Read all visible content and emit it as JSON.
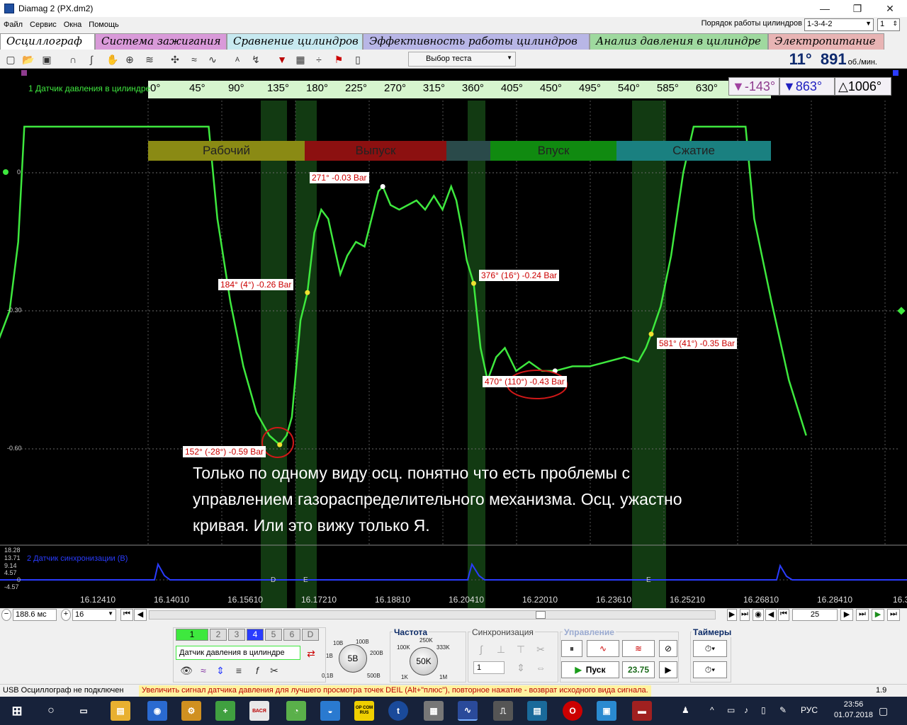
{
  "window": {
    "title": "Diamag 2 (PX.dm2)",
    "minimize": "—",
    "maximize": "❐",
    "close": "✕"
  },
  "menu": [
    "Файл",
    "Сервис",
    "Окна",
    "Помощь"
  ],
  "cylinder_order": {
    "label": "Порядок работы цилиндров",
    "value": "1-3-4-2",
    "cylinder": "1"
  },
  "tabs": [
    {
      "label": "Осциллограф",
      "color": "#ffffff",
      "active": true
    },
    {
      "label": "Система зажигания",
      "color": "#d99ad9"
    },
    {
      "label": "Сравнение цилиндров",
      "color": "#c7e9f0"
    },
    {
      "label": "Эффективность работы цилиндров",
      "color": "#b8b6e6"
    },
    {
      "label": "Анализ давления в цилиндре",
      "color": "#9fd99f"
    },
    {
      "label": "Электропитание",
      "color": "#e8b4b4"
    }
  ],
  "toolbar": {
    "test_select": "Выбор теста",
    "icons": [
      "new-file-icon",
      "open-icon",
      "save-icon",
      "trigger-rise-icon",
      "trigger-fall-icon",
      "hand-icon",
      "zoom-icon",
      "stack-icon",
      "cross-icon",
      "wave-icon",
      "wave-alt-icon",
      "auto-icon",
      "auto-zero-icon",
      "filter-icon",
      "grid-icon",
      "split-icon",
      "flag-icon",
      "page-icon"
    ]
  },
  "rpm": {
    "angle": "11°",
    "value": "891",
    "unit": "об./мин."
  },
  "scope": {
    "channel_title": "1 Датчик давления в цилиндре",
    "angle_labels": [
      "0°",
      "45°",
      "90°",
      "135°",
      "180°",
      "225°",
      "270°",
      "315°",
      "360°",
      "405°",
      "450°",
      "495°",
      "540°",
      "585°",
      "630°",
      "6"
    ],
    "phases": [
      {
        "label": "Рабочий",
        "color": "#8a8a14"
      },
      {
        "label": "Выпуск",
        "color": "#8c1010"
      },
      {
        "label": "",
        "color": "#2a4a4a"
      },
      {
        "label": "Впуск",
        "color": "#108a10"
      },
      {
        "label": "Сжатие",
        "color": "#1a8080"
      }
    ],
    "markers": {
      "m1": "-143°",
      "m2": "863°",
      "delta": "1006°"
    },
    "y_labels": [
      "0",
      "-0.30",
      "-0.60"
    ],
    "tags": [
      "271° -0.03 Bar",
      "184° (4°) -0.26 Bar",
      "376° (16°) -0.24 Bar",
      "581° (41°) -0.35 Bar",
      "470° (110°) -0.43 Bar",
      "152° (-28°) -0.59 Bar"
    ],
    "comment": "Только по одному виду осц. понятно что есть проблемы с управлением газораспределительного механизма. Осц. ужастно кривая. Или это вижу только Я.",
    "sync_title": "2 Датчик синхронизации (В)",
    "sync_labels": [
      "18.28",
      "13.71",
      "9.14",
      "4.57",
      "0",
      "-4.57"
    ],
    "sync_letters": [
      "D",
      "E",
      "E"
    ],
    "time_labels": [
      "16.12410",
      "16.14010",
      "16.15610",
      "16.17210",
      "16.18810",
      "16.20410",
      "16.22010",
      "16.23610",
      "16.25210",
      "16.26810",
      "16.28410",
      "16.3"
    ]
  },
  "chart_data": {
    "type": "line",
    "xlabel": "",
    "ylabel": "",
    "y_ticks": [
      0,
      -0.3,
      -0.6
    ],
    "x_ticks_deg": [
      0,
      45,
      90,
      135,
      180,
      225,
      270,
      315,
      360,
      405,
      450,
      495,
      540,
      585,
      630
    ],
    "series": [
      {
        "values_deg": [
          [
            -172,
            -0.36
          ],
          [
            -160,
            -0.3
          ],
          [
            -150,
            -0.15
          ],
          [
            -143,
            0.1
          ],
          [
            70,
            0.1
          ],
          [
            80,
            -0.1
          ],
          [
            95,
            -0.28
          ],
          [
            110,
            -0.42
          ],
          [
            125,
            -0.52
          ],
          [
            140,
            -0.57
          ],
          [
            152,
            -0.59
          ],
          [
            160,
            -0.57
          ],
          [
            166,
            -0.53
          ],
          [
            176,
            -0.32
          ],
          [
            184,
            -0.26
          ],
          [
            192,
            -0.13
          ],
          [
            200,
            -0.08
          ],
          [
            208,
            -0.1
          ],
          [
            215,
            -0.16
          ],
          [
            222,
            -0.22
          ],
          [
            230,
            -0.18
          ],
          [
            240,
            -0.15
          ],
          [
            250,
            -0.16
          ],
          [
            258,
            -0.1
          ],
          [
            266,
            -0.04
          ],
          [
            271,
            -0.03
          ],
          [
            280,
            -0.07
          ],
          [
            290,
            -0.08
          ],
          [
            300,
            -0.07
          ],
          [
            310,
            -0.06
          ],
          [
            320,
            -0.08
          ],
          [
            330,
            -0.05
          ],
          [
            340,
            -0.08
          ],
          [
            350,
            -0.03
          ],
          [
            356,
            -0.06
          ],
          [
            362,
            -0.12
          ],
          [
            368,
            -0.19
          ],
          [
            376,
            -0.24
          ],
          [
            384,
            -0.38
          ],
          [
            392,
            -0.45
          ],
          [
            402,
            -0.4
          ],
          [
            412,
            -0.38
          ],
          [
            425,
            -0.43
          ],
          [
            440,
            -0.41
          ],
          [
            455,
            -0.43
          ],
          [
            470,
            -0.43
          ],
          [
            490,
            -0.42
          ],
          [
            510,
            -0.42
          ],
          [
            530,
            -0.41
          ],
          [
            550,
            -0.4
          ],
          [
            566,
            -0.41
          ],
          [
            575,
            -0.38
          ],
          [
            581,
            -0.35
          ],
          [
            592,
            -0.29
          ],
          [
            604,
            -0.18
          ],
          [
            618,
            0.0
          ],
          [
            630,
            0.1
          ],
          [
            690,
            0.1
          ],
          [
            700,
            -0.1
          ],
          [
            720,
            -0.28
          ],
          [
            740,
            -0.45
          ],
          [
            760,
            -0.57
          ]
        ]
      }
    ],
    "markers": [
      {
        "angle": 271,
        "value": -0.03
      },
      {
        "angle": 184,
        "value": -0.26
      },
      {
        "angle": 376,
        "value": -0.24
      },
      {
        "angle": 581,
        "value": -0.35
      },
      {
        "angle": 470,
        "value": -0.43
      },
      {
        "angle": 152,
        "value": -0.59
      }
    ]
  },
  "scrollrow": {
    "time_div": "188.6 мс",
    "count": "16",
    "page": "25"
  },
  "panel": {
    "channels": [
      "1",
      "2",
      "3",
      "4",
      "5",
      "6",
      "D"
    ],
    "sensor": "Датчик давления в цилиндре",
    "volt_title": "",
    "volt_dial": "5В",
    "volt_ticks": [
      "10В",
      "100В",
      "1В",
      "200В",
      "0,1В",
      "500В"
    ],
    "freq_title": "Частота",
    "freq_dial": "50K",
    "freq_ticks": [
      "250K",
      "100K",
      "333K",
      "1K",
      "1M"
    ],
    "sync_title": "Синхронизация",
    "sync_value": "1",
    "control_title": "Управление",
    "start_label": "Пуск",
    "fps": "23.75",
    "timers_title": "Таймеры"
  },
  "status": {
    "left": "USB Осциллограф не подключен",
    "hint": "Увеличить сигнал датчика давления для лучшего просмотра точек DEIL (Alt+\"плюс\"), повторное нажатие - возврат исходного вида сигнала.",
    "right": "1.9"
  },
  "taskbar": {
    "lang": "РУС",
    "time": "23:56",
    "date": "01.07.2018",
    "apps": [
      "ВАСЯ",
      "ОР COM RUS"
    ]
  }
}
